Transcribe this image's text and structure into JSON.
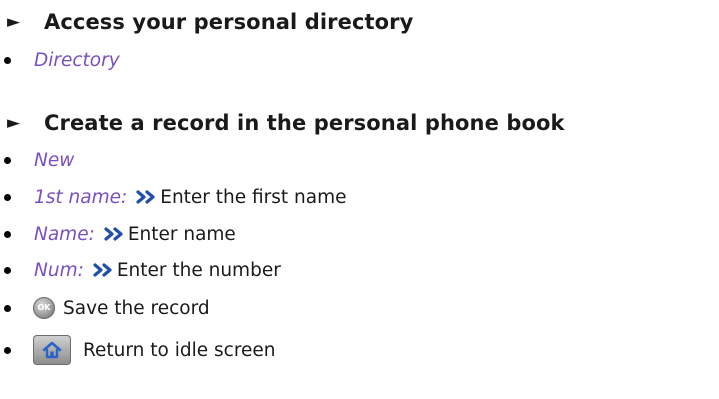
{
  "section1": {
    "arrow": "►",
    "heading": "Access your personal directory",
    "items": [
      {
        "term": "Directory"
      }
    ]
  },
  "section2": {
    "arrow": "►",
    "heading": "Create a record in the personal phone book",
    "items": [
      {
        "term": "New"
      },
      {
        "term": "1st name:",
        "text": "Enter the first name"
      },
      {
        "term": "Name:",
        "text": "Enter name"
      },
      {
        "term": "Num:",
        "text": "Enter the number"
      },
      {
        "icon": "ok-key-icon",
        "icon_label": "OK",
        "text": "Save the record"
      },
      {
        "icon": "home-key-icon",
        "text": "Return to idle screen"
      }
    ]
  },
  "colors": {
    "menu_term": "#7a4fc2",
    "body_text": "#1a1a1a",
    "chevron": "#1f4fa8"
  }
}
